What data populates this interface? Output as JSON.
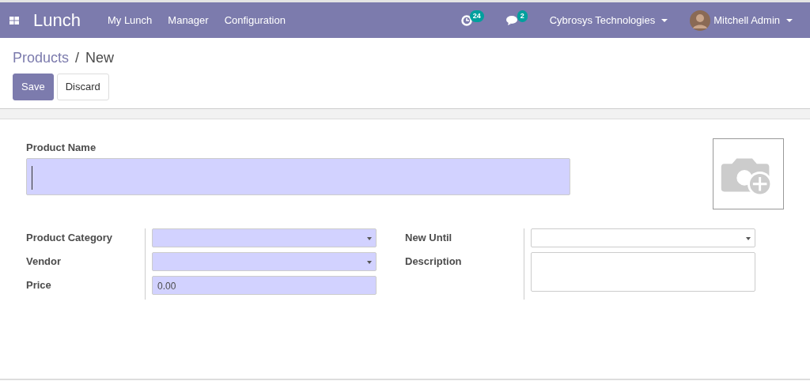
{
  "navbar": {
    "app_name": "Lunch",
    "menu": [
      "My Lunch",
      "Manager",
      "Configuration"
    ],
    "activity_count": "24",
    "message_count": "2",
    "company": "Cybrosys Technologies",
    "user": "Mitchell Admin"
  },
  "breadcrumb": [
    {
      "label": "Products",
      "kind": "link"
    },
    {
      "label": "/",
      "kind": "separator"
    },
    {
      "label": "New",
      "kind": "current"
    }
  ],
  "buttons": [
    {
      "label": "Save",
      "kind": "primary"
    },
    {
      "label": "Discard",
      "kind": "secondary"
    }
  ],
  "form": {
    "title_label": "Product Name",
    "title_required": true,
    "left_fields": [
      {
        "label": "Product Category",
        "kind": "select",
        "required": true
      },
      {
        "label": "Vendor",
        "kind": "select",
        "required": true
      },
      {
        "label": "Price",
        "kind": "text",
        "value": "0.00",
        "required": true
      }
    ],
    "right_fields": [
      {
        "label": "New Until",
        "kind": "select",
        "required": false
      },
      {
        "label": "Description",
        "kind": "textarea",
        "required": false
      }
    ]
  }
}
